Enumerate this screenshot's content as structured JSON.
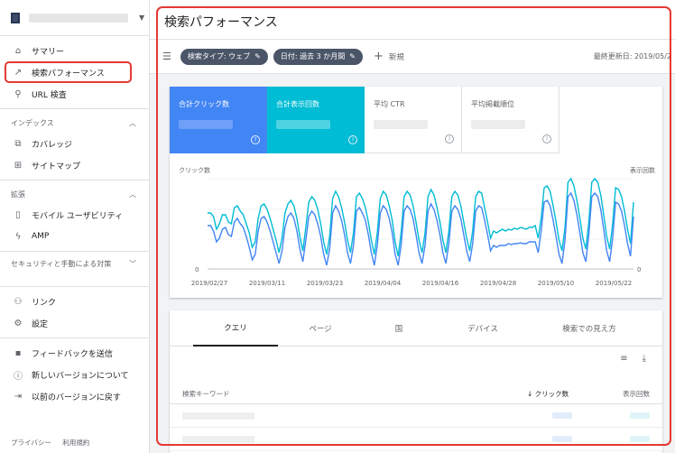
{
  "sidebar": {
    "groups": [
      {
        "items": [
          {
            "label": "サマリー",
            "icon": "home-icon",
            "glyph": "⌂",
            "name": "sidebar-item-summary"
          },
          {
            "label": "検索パフォーマンス",
            "icon": "trending-up-icon",
            "glyph": "↗",
            "name": "sidebar-item-performance",
            "active": true
          },
          {
            "label": "URL 検査",
            "icon": "search-icon",
            "glyph": "⚲",
            "name": "sidebar-item-url-inspection"
          }
        ]
      }
    ],
    "index_header": "インデックス",
    "index_items": [
      {
        "label": "カバレッジ",
        "icon": "copy-icon",
        "glyph": "⧉"
      },
      {
        "label": "サイトマップ",
        "icon": "sitemap-icon",
        "glyph": "⊞"
      }
    ],
    "enhance_header": "拡張",
    "enhance_items": [
      {
        "label": "モバイル ユーザビリティ",
        "icon": "phone-icon",
        "glyph": "▯"
      },
      {
        "label": "AMP",
        "icon": "bolt-icon",
        "glyph": "ϟ"
      }
    ],
    "security_header": "セキュリティと手動による対策",
    "bottom_items": [
      {
        "label": "リンク",
        "icon": "network-icon",
        "glyph": "⚇"
      },
      {
        "label": "設定",
        "icon": "gear-icon",
        "glyph": "⚙"
      }
    ],
    "feedback_items": [
      {
        "label": "フィードバックを送信",
        "icon": "feedback-icon",
        "glyph": "▪"
      },
      {
        "label": "新しいバージョンについて",
        "icon": "info-icon",
        "glyph": "ⓘ"
      },
      {
        "label": "以前のバージョンに戻す",
        "icon": "exit-icon",
        "glyph": "⇥"
      }
    ],
    "footer": {
      "privacy": "プライバシー",
      "terms": "利用規約"
    }
  },
  "main": {
    "title": "検索パフォーマンス",
    "filters": {
      "search_type": "検索タイプ: ウェブ",
      "date": "日付: 過去 3 か月間",
      "new": "新規"
    },
    "updated": "最終更新日: 2019/05/2",
    "metrics": [
      {
        "label": "合計クリック数"
      },
      {
        "label": "合計表示回数"
      },
      {
        "label": "平均 CTR"
      },
      {
        "label": "平均掲載順位"
      }
    ],
    "colors": {
      "clicks": "#4285f4",
      "impressions": "#00bcd4",
      "highlight": "#e53935"
    }
  },
  "chart_data": {
    "type": "line",
    "left_axis_label": "クリック数",
    "right_axis_label": "表示回数",
    "y_min_label_left": "0",
    "y_min_label_right": "0",
    "x_tick_labels": [
      "2019/02/27",
      "2019/03/11",
      "2019/03/23",
      "2019/04/04",
      "2019/04/16",
      "2019/04/28",
      "2019/05/10",
      "2019/05/22"
    ],
    "series": [
      {
        "values": [
          0.62,
          0.62,
          0.58,
          0.44,
          0.5,
          0.6,
          0.6,
          0.52,
          0.5,
          0.68,
          0.7,
          0.64,
          0.6,
          0.5,
          0.4,
          0.24,
          0.3,
          0.56,
          0.7,
          0.72,
          0.66,
          0.56,
          0.44,
          0.32,
          0.18,
          0.34,
          0.62,
          0.72,
          0.76,
          0.7,
          0.56,
          0.36,
          0.2,
          0.46,
          0.74,
          0.8,
          0.76,
          0.66,
          0.5,
          0.3,
          0.16,
          0.36,
          0.78,
          0.86,
          0.8,
          0.68,
          0.52,
          0.32,
          0.18,
          0.4,
          0.8,
          0.84,
          0.78,
          0.68,
          0.52,
          0.32,
          0.16,
          0.4,
          0.78,
          0.86,
          0.82,
          0.7,
          0.54,
          0.3,
          0.14,
          0.4,
          0.8,
          0.86,
          0.82,
          0.7,
          0.52,
          0.32,
          0.18,
          0.4,
          0.8,
          0.88,
          0.82,
          0.68,
          0.52,
          0.32,
          0.18,
          0.42,
          0.8,
          0.86,
          0.82,
          0.7,
          0.52,
          0.34,
          0.2,
          0.42,
          0.8,
          0.86,
          0.84,
          0.68,
          0.52,
          0.34,
          0.42,
          0.4,
          0.42,
          0.44,
          0.42,
          0.44,
          0.43,
          0.45,
          0.44,
          0.46,
          0.45,
          0.44,
          0.46,
          0.46,
          0.48,
          0.34,
          0.56,
          0.9,
          0.92,
          0.86,
          0.7,
          0.52,
          0.32,
          0.2,
          0.46,
          0.96,
          1.0,
          0.92,
          0.76,
          0.56,
          0.34,
          0.22,
          0.52,
          0.96,
          1.0,
          0.96,
          0.82,
          0.6,
          0.36,
          0.22,
          0.5,
          0.9,
          0.88,
          0.8,
          0.64,
          0.44,
          0.28,
          0.74
        ]
      },
      {
        "values": [
          0.48,
          0.48,
          0.42,
          0.3,
          0.34,
          0.44,
          0.46,
          0.38,
          0.36,
          0.52,
          0.56,
          0.5,
          0.46,
          0.36,
          0.24,
          0.1,
          0.16,
          0.42,
          0.56,
          0.58,
          0.52,
          0.42,
          0.3,
          0.18,
          0.06,
          0.2,
          0.46,
          0.58,
          0.62,
          0.56,
          0.42,
          0.22,
          0.08,
          0.32,
          0.58,
          0.64,
          0.6,
          0.5,
          0.36,
          0.16,
          0.04,
          0.22,
          0.62,
          0.7,
          0.64,
          0.54,
          0.38,
          0.18,
          0.06,
          0.26,
          0.64,
          0.68,
          0.62,
          0.54,
          0.38,
          0.18,
          0.04,
          0.26,
          0.62,
          0.7,
          0.66,
          0.56,
          0.4,
          0.16,
          0.04,
          0.26,
          0.64,
          0.7,
          0.66,
          0.56,
          0.38,
          0.18,
          0.06,
          0.26,
          0.64,
          0.72,
          0.66,
          0.54,
          0.38,
          0.18,
          0.06,
          0.28,
          0.64,
          0.7,
          0.66,
          0.56,
          0.38,
          0.2,
          0.08,
          0.28,
          0.64,
          0.7,
          0.68,
          0.54,
          0.38,
          0.2,
          0.26,
          0.24,
          0.26,
          0.26,
          0.26,
          0.28,
          0.27,
          0.28,
          0.28,
          0.29,
          0.28,
          0.28,
          0.3,
          0.3,
          0.3,
          0.18,
          0.42,
          0.74,
          0.76,
          0.7,
          0.54,
          0.36,
          0.16,
          0.06,
          0.32,
          0.8,
          0.84,
          0.76,
          0.6,
          0.4,
          0.18,
          0.08,
          0.38,
          0.8,
          0.84,
          0.8,
          0.66,
          0.44,
          0.2,
          0.08,
          0.34,
          0.74,
          0.72,
          0.64,
          0.48,
          0.28,
          0.14,
          0.58
        ]
      }
    ]
  },
  "table": {
    "tabs": [
      "クエリ",
      "ページ",
      "国",
      "デバイス",
      "検索での見え方"
    ],
    "active_tab": 0,
    "col_keyword": "検索キーワード",
    "col_clicks": "↓ クリック数",
    "col_impressions": "表示回数",
    "filter_icon": "filter-icon",
    "download_icon": "download-icon"
  }
}
